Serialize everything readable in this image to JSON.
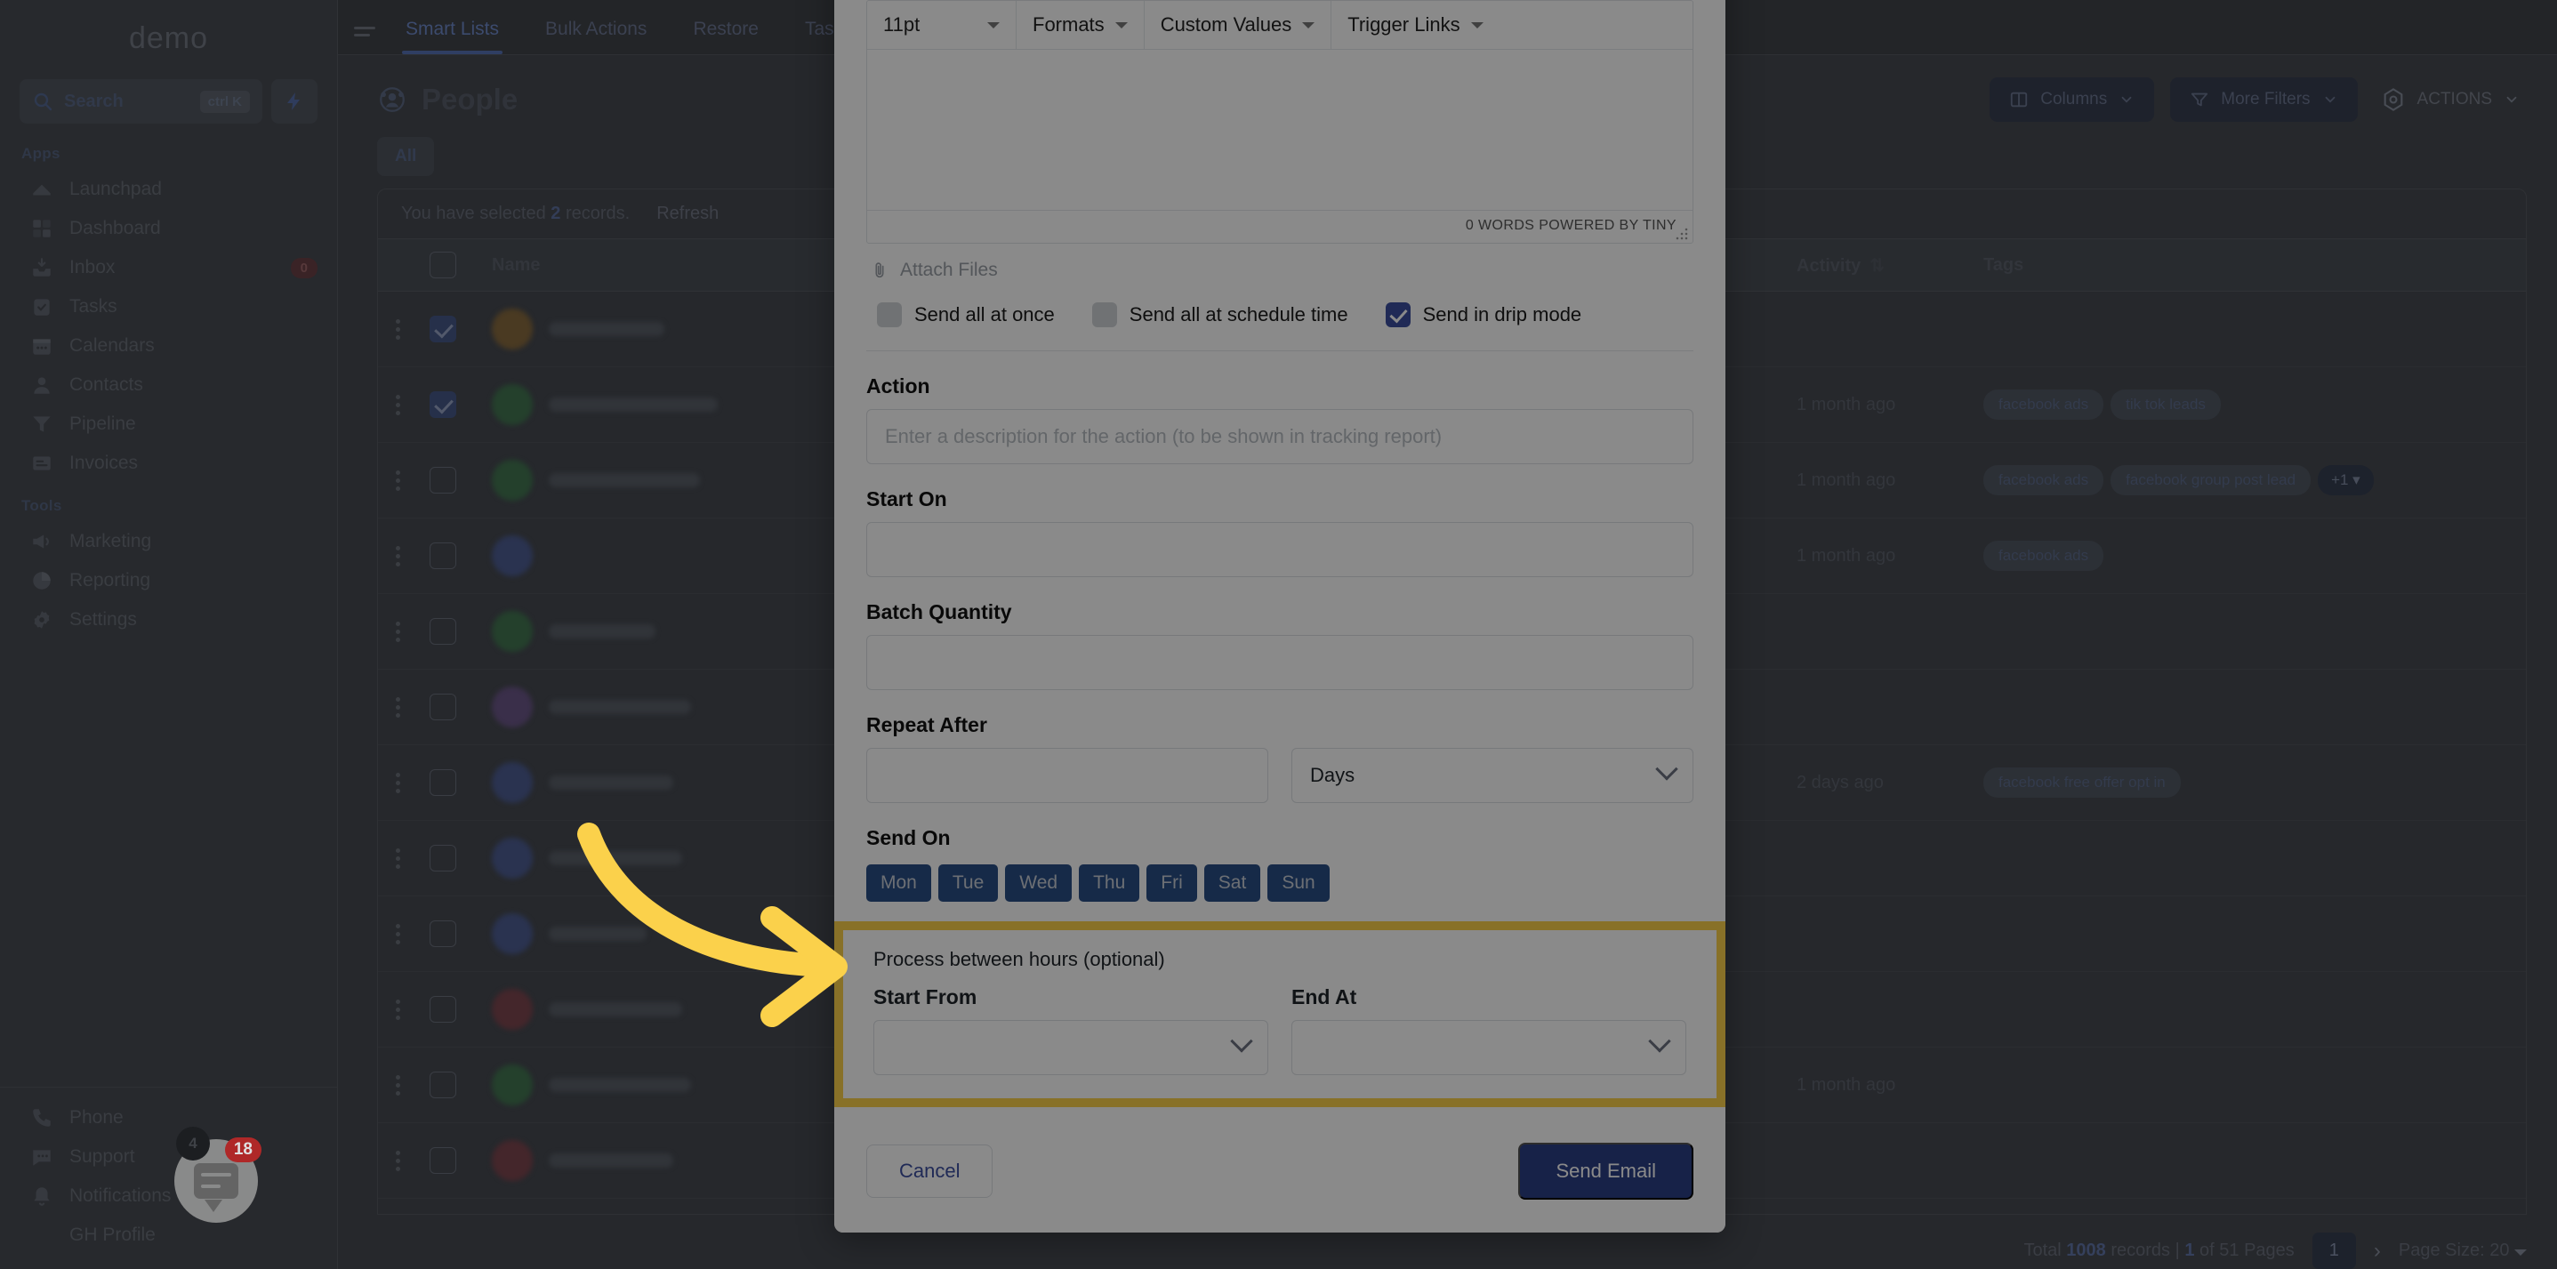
{
  "app": {
    "brand": "demo",
    "search": {
      "label": "Search",
      "shortcut": "ctrl K",
      "icon": "search-icon"
    },
    "sections": [
      {
        "title": "Apps",
        "items": [
          {
            "label": "Launchpad",
            "icon": "launchpad-icon"
          },
          {
            "label": "Dashboard",
            "icon": "dashboard-icon"
          },
          {
            "label": "Inbox",
            "icon": "inbox-icon",
            "badge": "0"
          },
          {
            "label": "Tasks",
            "icon": "tasks-icon"
          },
          {
            "label": "Calendars",
            "icon": "calendar-icon"
          },
          {
            "label": "Contacts",
            "icon": "contacts-icon"
          },
          {
            "label": "Pipeline",
            "icon": "pipeline-icon"
          },
          {
            "label": "Invoices",
            "icon": "invoices-icon"
          }
        ]
      },
      {
        "title": "Tools",
        "items": [
          {
            "label": "Marketing",
            "icon": "megaphone-icon"
          },
          {
            "label": "Reporting",
            "icon": "chart-pie-icon"
          },
          {
            "label": "Settings",
            "icon": "gear-icon"
          }
        ]
      }
    ],
    "bottom_items": [
      {
        "label": "Phone",
        "icon": "phone-icon"
      },
      {
        "label": "Support",
        "icon": "support-chat-icon"
      },
      {
        "label": "Notifications",
        "icon": "bell-icon",
        "badge": "4"
      },
      {
        "label": "GH Profile",
        "icon": "avatar-icon"
      }
    ],
    "chat_widget": {
      "badge": "18",
      "icon": "chat-bubble-icon"
    }
  },
  "header": {
    "tabs": [
      {
        "label": "Smart Lists",
        "active": true
      },
      {
        "label": "Bulk Actions",
        "active": false
      },
      {
        "label": "Restore",
        "active": false
      },
      {
        "label": "Tasks",
        "active": false
      }
    ],
    "page_title": "People",
    "page_icon": "people-icon",
    "buttons": [
      {
        "label": "Columns",
        "icon": "columns-icon",
        "style": "dark"
      },
      {
        "label": "More Filters",
        "icon": "filter-icon",
        "style": "dark"
      },
      {
        "label": "ACTIONS",
        "icon": "actions-icon",
        "style": "plain"
      }
    ],
    "filter_chip": "All"
  },
  "table": {
    "selection_prefix": "You have selected",
    "selection_count": "2",
    "selection_suffix": "records.",
    "refresh_label": "Refresh",
    "columns": [
      "Name",
      "Activity",
      "Tags"
    ],
    "rows": [
      {
        "selected": true,
        "avatar": "#4a3a22",
        "name_w": 130,
        "activity": "",
        "tags": []
      },
      {
        "selected": true,
        "avatar": "#24402c",
        "name_w": 190,
        "activity": "1 month ago",
        "tags": [
          "facebook ads",
          "tik tok leads"
        ]
      },
      {
        "selected": false,
        "avatar": "#24402c",
        "name_w": 170,
        "activity": "1 month ago",
        "tags": [
          "facebook ads",
          "facebook group post lead"
        ],
        "more": "+1"
      },
      {
        "selected": false,
        "avatar": "#2a3350",
        "name_w": 0,
        "activity": "1 month ago",
        "tags": [
          "facebook ads"
        ]
      },
      {
        "selected": false,
        "avatar": "#24402c",
        "name_w": 120,
        "activity": "",
        "tags": []
      },
      {
        "selected": false,
        "avatar": "#3a2f4a",
        "name_w": 160,
        "activity": "",
        "tags": []
      },
      {
        "selected": false,
        "avatar": "#2a3350",
        "name_w": 140,
        "activity": "2 days ago",
        "tags": [
          "facebook free offer opt in"
        ]
      },
      {
        "selected": false,
        "avatar": "#2a3350",
        "name_w": 150,
        "activity": "",
        "tags": []
      },
      {
        "selected": false,
        "avatar": "#2a3350",
        "name_w": 110,
        "activity": "",
        "tags": []
      },
      {
        "selected": false,
        "avatar": "#44262b",
        "name_w": 150,
        "activity": "",
        "tags": []
      },
      {
        "selected": false,
        "avatar": "#24402c",
        "name_w": 160,
        "activity": "1 month ago",
        "tags": []
      },
      {
        "selected": false,
        "avatar": "#44262b",
        "name_w": 140,
        "activity": "",
        "tags": []
      }
    ],
    "pagination": {
      "total_prefix": "Total",
      "total_count": "1008",
      "total_mid": "records |",
      "page_current": "1",
      "page_of": "of 51 Pages",
      "page_number_box": "1",
      "next_arrow": "›",
      "page_size_label": "Page Size: 20"
    }
  },
  "modal": {
    "editor": {
      "font_size": "11pt",
      "formats_label": "Formats",
      "custom_values_label": "Custom Values",
      "trigger_links_label": "Trigger Links",
      "status": "0 WORDS POWERED BY TINY"
    },
    "attach_label": "Attach Files",
    "attach_icon": "paperclip-icon",
    "send_modes": [
      {
        "label": "Send all at once",
        "checked": false
      },
      {
        "label": "Send all at schedule time",
        "checked": false
      },
      {
        "label": "Send in drip mode",
        "checked": true
      }
    ],
    "action": {
      "label": "Action",
      "value": "",
      "placeholder": "Enter a description for the action (to be shown in tracking report)"
    },
    "start_on": {
      "label": "Start On",
      "value": ""
    },
    "batch_quantity": {
      "label": "Batch Quantity",
      "value": ""
    },
    "repeat_after": {
      "label": "Repeat After",
      "value": "",
      "unit": "Days"
    },
    "send_on": {
      "label": "Send On",
      "days": [
        "Mon",
        "Tue",
        "Wed",
        "Thu",
        "Fri",
        "Sat",
        "Sun"
      ]
    },
    "process_hours": {
      "title": "Process between hours (optional)",
      "start_from_label": "Start From",
      "start_from_value": "",
      "end_at_label": "End At",
      "end_at_value": ""
    },
    "cancel_label": "Cancel",
    "send_label": "Send Email"
  },
  "annotation": {
    "arrow_color": "#fbd14b",
    "highlight_color": "#fbd14b"
  }
}
